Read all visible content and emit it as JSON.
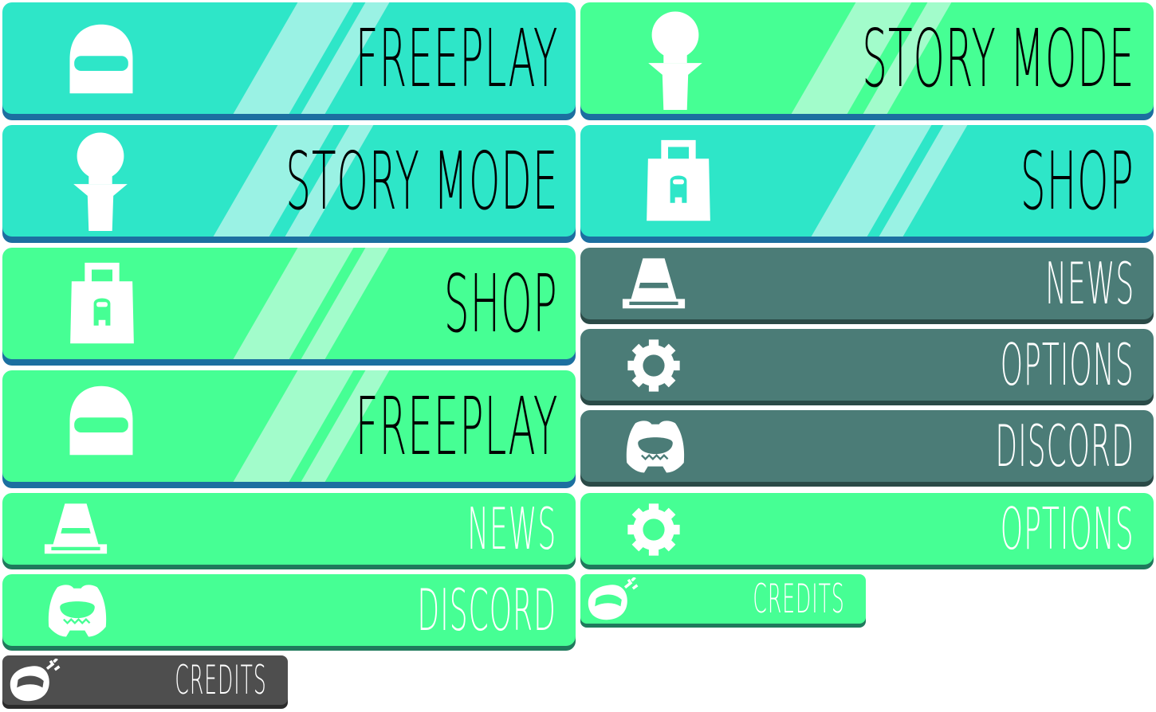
{
  "colors": {
    "teal": "#2ee6c8",
    "teal_shadow": "#1c6fa0",
    "teal_stripe": "#9af2e4",
    "green": "#46ff94",
    "green_shadow": "#1f7a5c",
    "green_stripe": "#a2fccb",
    "slate": "#4b7c77",
    "slate_shadow": "#2b4a47",
    "dark_gray": "#4e4e4e",
    "dark_shadow": "#2b2b2b",
    "label_dark": "#000000",
    "label_light": "#ffffff"
  },
  "left": {
    "freeplay_teal": "FREEPLAY",
    "story_mode_teal": "STORY MODE",
    "shop_green": "SHOP",
    "freeplay_green": "FREEPLAY",
    "news_green": "NEWS",
    "discord_green": "DISCORD",
    "credits_gray": "CREDITS"
  },
  "right": {
    "story_mode_green": "STORY MODE",
    "shop_teal": "SHOP",
    "news_slate": "NEWS",
    "options_slate": "OPTIONS",
    "discord_slate": "DISCORD",
    "options_green": "OPTIONS",
    "credits_green": "CREDITS"
  },
  "icons": [
    "helmet-icon",
    "cone-head-icon",
    "bag-icon",
    "traffic-cone-icon",
    "gear-icon",
    "discord-icon",
    "credits-face-icon"
  ]
}
